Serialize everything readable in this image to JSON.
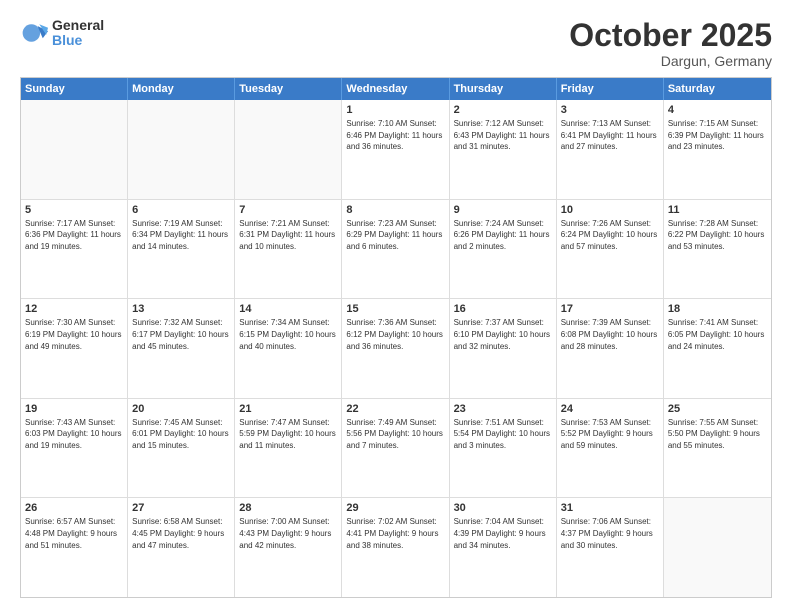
{
  "logo": {
    "general": "General",
    "blue": "Blue"
  },
  "header": {
    "month": "October 2025",
    "location": "Dargun, Germany"
  },
  "days_of_week": [
    "Sunday",
    "Monday",
    "Tuesday",
    "Wednesday",
    "Thursday",
    "Friday",
    "Saturday"
  ],
  "weeks": [
    [
      {
        "day": "",
        "info": ""
      },
      {
        "day": "",
        "info": ""
      },
      {
        "day": "",
        "info": ""
      },
      {
        "day": "1",
        "info": "Sunrise: 7:10 AM\nSunset: 6:46 PM\nDaylight: 11 hours\nand 36 minutes."
      },
      {
        "day": "2",
        "info": "Sunrise: 7:12 AM\nSunset: 6:43 PM\nDaylight: 11 hours\nand 31 minutes."
      },
      {
        "day": "3",
        "info": "Sunrise: 7:13 AM\nSunset: 6:41 PM\nDaylight: 11 hours\nand 27 minutes."
      },
      {
        "day": "4",
        "info": "Sunrise: 7:15 AM\nSunset: 6:39 PM\nDaylight: 11 hours\nand 23 minutes."
      }
    ],
    [
      {
        "day": "5",
        "info": "Sunrise: 7:17 AM\nSunset: 6:36 PM\nDaylight: 11 hours\nand 19 minutes."
      },
      {
        "day": "6",
        "info": "Sunrise: 7:19 AM\nSunset: 6:34 PM\nDaylight: 11 hours\nand 14 minutes."
      },
      {
        "day": "7",
        "info": "Sunrise: 7:21 AM\nSunset: 6:31 PM\nDaylight: 11 hours\nand 10 minutes."
      },
      {
        "day": "8",
        "info": "Sunrise: 7:23 AM\nSunset: 6:29 PM\nDaylight: 11 hours\nand 6 minutes."
      },
      {
        "day": "9",
        "info": "Sunrise: 7:24 AM\nSunset: 6:26 PM\nDaylight: 11 hours\nand 2 minutes."
      },
      {
        "day": "10",
        "info": "Sunrise: 7:26 AM\nSunset: 6:24 PM\nDaylight: 10 hours\nand 57 minutes."
      },
      {
        "day": "11",
        "info": "Sunrise: 7:28 AM\nSunset: 6:22 PM\nDaylight: 10 hours\nand 53 minutes."
      }
    ],
    [
      {
        "day": "12",
        "info": "Sunrise: 7:30 AM\nSunset: 6:19 PM\nDaylight: 10 hours\nand 49 minutes."
      },
      {
        "day": "13",
        "info": "Sunrise: 7:32 AM\nSunset: 6:17 PM\nDaylight: 10 hours\nand 45 minutes."
      },
      {
        "day": "14",
        "info": "Sunrise: 7:34 AM\nSunset: 6:15 PM\nDaylight: 10 hours\nand 40 minutes."
      },
      {
        "day": "15",
        "info": "Sunrise: 7:36 AM\nSunset: 6:12 PM\nDaylight: 10 hours\nand 36 minutes."
      },
      {
        "day": "16",
        "info": "Sunrise: 7:37 AM\nSunset: 6:10 PM\nDaylight: 10 hours\nand 32 minutes."
      },
      {
        "day": "17",
        "info": "Sunrise: 7:39 AM\nSunset: 6:08 PM\nDaylight: 10 hours\nand 28 minutes."
      },
      {
        "day": "18",
        "info": "Sunrise: 7:41 AM\nSunset: 6:05 PM\nDaylight: 10 hours\nand 24 minutes."
      }
    ],
    [
      {
        "day": "19",
        "info": "Sunrise: 7:43 AM\nSunset: 6:03 PM\nDaylight: 10 hours\nand 19 minutes."
      },
      {
        "day": "20",
        "info": "Sunrise: 7:45 AM\nSunset: 6:01 PM\nDaylight: 10 hours\nand 15 minutes."
      },
      {
        "day": "21",
        "info": "Sunrise: 7:47 AM\nSunset: 5:59 PM\nDaylight: 10 hours\nand 11 minutes."
      },
      {
        "day": "22",
        "info": "Sunrise: 7:49 AM\nSunset: 5:56 PM\nDaylight: 10 hours\nand 7 minutes."
      },
      {
        "day": "23",
        "info": "Sunrise: 7:51 AM\nSunset: 5:54 PM\nDaylight: 10 hours\nand 3 minutes."
      },
      {
        "day": "24",
        "info": "Sunrise: 7:53 AM\nSunset: 5:52 PM\nDaylight: 9 hours\nand 59 minutes."
      },
      {
        "day": "25",
        "info": "Sunrise: 7:55 AM\nSunset: 5:50 PM\nDaylight: 9 hours\nand 55 minutes."
      }
    ],
    [
      {
        "day": "26",
        "info": "Sunrise: 6:57 AM\nSunset: 4:48 PM\nDaylight: 9 hours\nand 51 minutes."
      },
      {
        "day": "27",
        "info": "Sunrise: 6:58 AM\nSunset: 4:45 PM\nDaylight: 9 hours\nand 47 minutes."
      },
      {
        "day": "28",
        "info": "Sunrise: 7:00 AM\nSunset: 4:43 PM\nDaylight: 9 hours\nand 42 minutes."
      },
      {
        "day": "29",
        "info": "Sunrise: 7:02 AM\nSunset: 4:41 PM\nDaylight: 9 hours\nand 38 minutes."
      },
      {
        "day": "30",
        "info": "Sunrise: 7:04 AM\nSunset: 4:39 PM\nDaylight: 9 hours\nand 34 minutes."
      },
      {
        "day": "31",
        "info": "Sunrise: 7:06 AM\nSunset: 4:37 PM\nDaylight: 9 hours\nand 30 minutes."
      },
      {
        "day": "",
        "info": ""
      }
    ]
  ]
}
